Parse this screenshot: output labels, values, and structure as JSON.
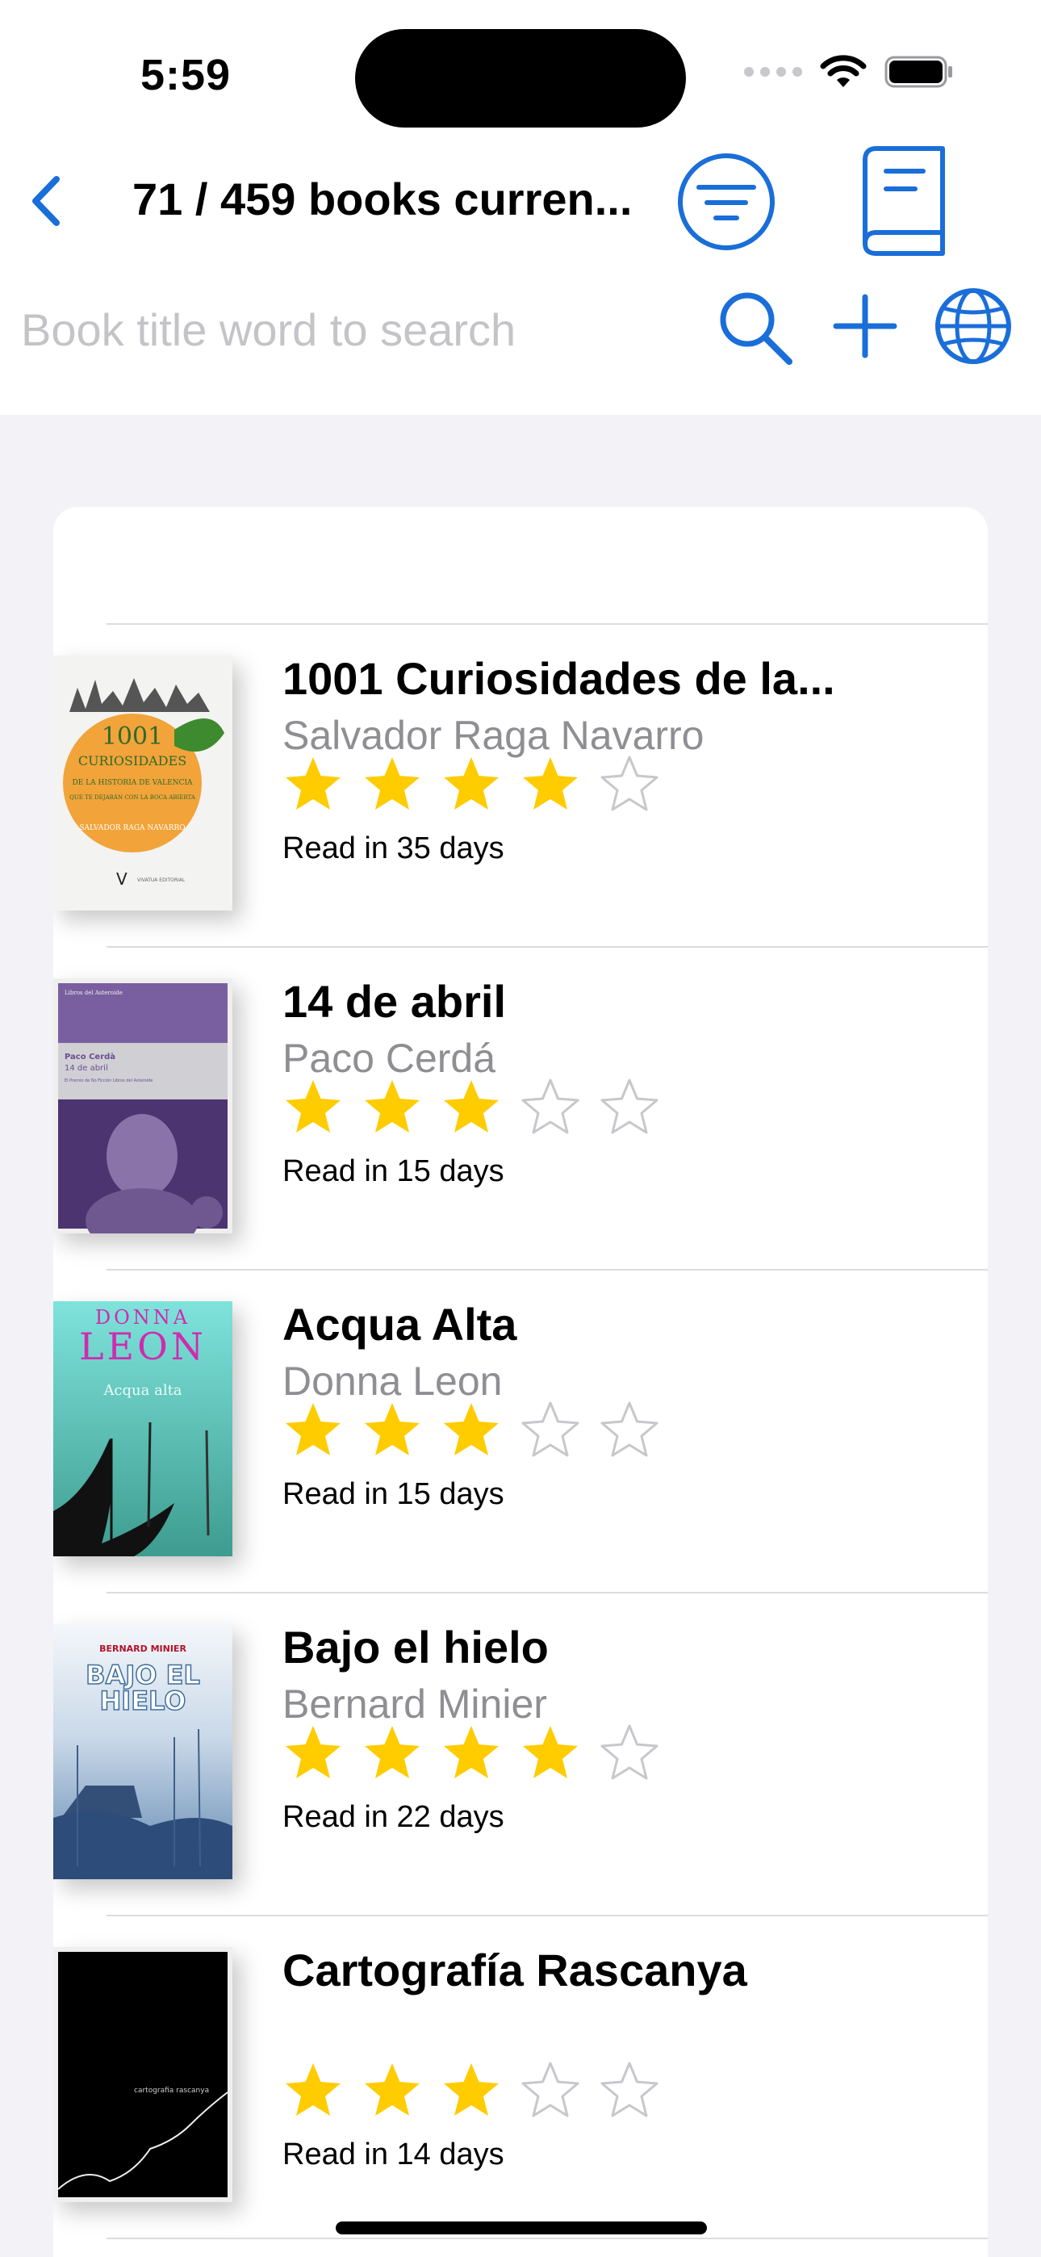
{
  "status_bar": {
    "time": "5:59",
    "icons": [
      "cellular-signal-icon",
      "wifi-icon",
      "battery-icon"
    ]
  },
  "nav": {
    "back_icon": "chevron-left-icon",
    "title": "71 / 459 books curren...",
    "filter_icon": "filter-lines-circle-icon",
    "book_icon": "book-closed-icon"
  },
  "search": {
    "placeholder": "Book title word to search",
    "value": "",
    "icons": [
      "magnifying-glass-icon",
      "plus-icon",
      "globe-icon"
    ]
  },
  "colors": {
    "accent": "#1a6ed8",
    "star_filled": "#ffcc00",
    "star_empty": "#c7c7cc",
    "author_gray": "#8e8e93",
    "background": "#f2f2f7"
  },
  "books": [
    {
      "title": "1001 Curiosidades de la...",
      "author": "Salvador Raga Navarro",
      "rating": 4,
      "max_rating": 5,
      "read_time": "Read in 35 days",
      "cover": {
        "big_text": "1001",
        "sub_text": "CURIOSIDADES",
        "line2": "DE LA HISTORIA DE VALENCIA",
        "line3": "QUE TE DEJARÁN CON LA BOCA ABIERTA",
        "author_line": "SALVADOR RAGA NAVARRO",
        "publisher": "VIVATUA EDITORIAL"
      }
    },
    {
      "title": "14 de abril",
      "author": "Paco Cerdá",
      "rating": 3,
      "max_rating": 5,
      "read_time": "Read in 15 days",
      "cover": {
        "top_line": "Libros del Asteroide",
        "author_line": "Paco Cerdà",
        "title_line": "14 de abril",
        "note_line": "El Premio de No Ficción Libros del Asteroide"
      }
    },
    {
      "title": "Acqua Alta",
      "author": "Donna Leon",
      "rating": 3,
      "max_rating": 5,
      "read_time": "Read in 15 days",
      "cover": {
        "first_name": "DONNA",
        "last_name": "LEON",
        "title_line": "Acqua alta"
      }
    },
    {
      "title": "Bajo el hielo",
      "author": "Bernard Minier",
      "rating": 4,
      "max_rating": 5,
      "read_time": "Read in 22 days",
      "cover": {
        "author_line": "BERNARD MINIER",
        "title_line1": "BAJO EL",
        "title_line2": "HIELO"
      }
    },
    {
      "title": "Cartografía Rascanya",
      "author": "",
      "rating": 3,
      "max_rating": 5,
      "read_time": "Read in 14 days",
      "cover": {
        "title_line": "cartografia rascanya"
      }
    }
  ]
}
